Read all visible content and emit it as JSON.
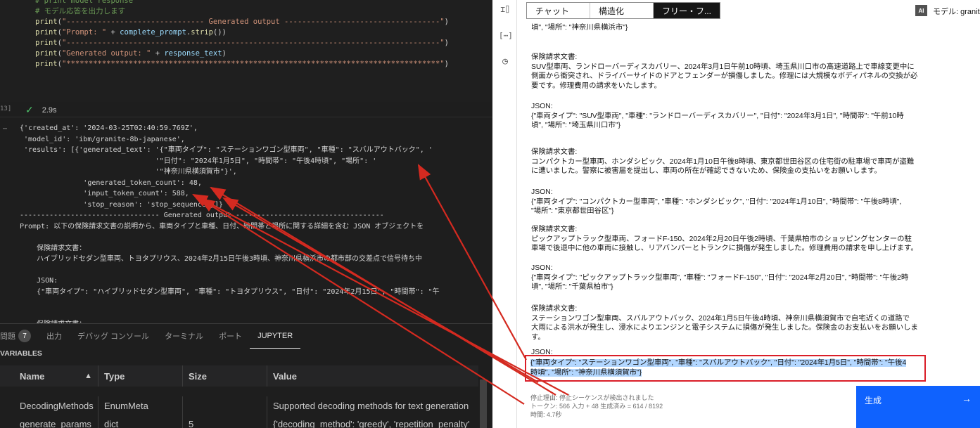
{
  "code": {
    "lines": [
      {
        "parts": [
          {
            "cls": "c-com",
            "t": "# print model response"
          }
        ]
      },
      {
        "parts": [
          {
            "cls": "c-com",
            "t": "# モデル応答を出力します"
          }
        ]
      },
      {
        "parts": [
          {
            "cls": "c-fn",
            "t": "print"
          },
          {
            "cls": "",
            "t": "("
          },
          {
            "cls": "c-str",
            "t": "\"------------------------------- Generated output -----------------------------------\""
          },
          {
            "cls": "",
            "t": ")"
          }
        ]
      },
      {
        "parts": [
          {
            "cls": "c-fn",
            "t": "print"
          },
          {
            "cls": "",
            "t": "("
          },
          {
            "cls": "c-str",
            "t": "\"Prompt: \""
          },
          {
            "cls": "",
            "t": " + "
          },
          {
            "cls": "c-var",
            "t": "complete_prompt"
          },
          {
            "cls": "",
            "t": "."
          },
          {
            "cls": "c-fn",
            "t": "strip"
          },
          {
            "cls": "",
            "t": "())"
          }
        ]
      },
      {
        "parts": [
          {
            "cls": "c-fn",
            "t": "print"
          },
          {
            "cls": "",
            "t": "("
          },
          {
            "cls": "c-str",
            "t": "\"------------------------------------------------------------------------------------\""
          },
          {
            "cls": "",
            "t": ")"
          }
        ]
      },
      {
        "parts": [
          {
            "cls": "c-fn",
            "t": "print"
          },
          {
            "cls": "",
            "t": "("
          },
          {
            "cls": "c-str",
            "t": "\"Generated output: \""
          },
          {
            "cls": "",
            "t": " + "
          },
          {
            "cls": "c-var",
            "t": "response_text"
          },
          {
            "cls": "",
            "t": ")"
          }
        ]
      },
      {
        "parts": [
          {
            "cls": "c-fn",
            "t": "print"
          },
          {
            "cls": "",
            "t": "("
          },
          {
            "cls": "c-str",
            "t": "\"************************************************************************************\""
          },
          {
            "cls": "",
            "t": ")"
          }
        ]
      }
    ],
    "cell_number": "13]",
    "elapsed": "2.9s"
  },
  "output": {
    "lines": [
      "{'created_at': '2024-03-25T02:40:59.769Z',",
      " 'model_id': 'ibm/granite-8b-japanese',",
      " 'results': [{'generated_text': '{\"車両タイプ\": \"ステーションワゴン型車両\", \"車種\": \"スバルアウトバック\", '",
      "                                '\"日付\": \"2024年1月5日\", \"時間帯\": \"午後4時頃\", \"場所\": '",
      "                                '\"神奈川県横須賀市\"}',",
      "               'generated_token_count': 48,",
      "               'input_token_count': 588,",
      "               'stop_reason': 'stop_sequence'}]}",
      "--------------------------------- Generated output -----------------------------------",
      "Prompt: 以下の保険請求文書の説明から、車両タイプと車種、日付、時間帯と場所に関する詳細を含む JSON オブジェクトを",
      "",
      "    保険請求文書：",
      "    ハイブリッドセダン型車両、トヨタプリウス、2024年2月15日午後3時頃、神奈川県横浜市の都市部の交差点で信号待ち中",
      "",
      "    JSON:",
      "    {\"車両タイプ\": \"ハイブリッドセダン型車両\", \"車種\": \"トヨタプリウス\", \"日付\": \"2024年2月15日\", \"時間帯\": \"午",
      "",
      "",
      "    保険請求文書："
    ]
  },
  "panel": {
    "tabs": [
      {
        "label": "問題",
        "badge": "7"
      },
      {
        "label": "出力"
      },
      {
        "label": "デバッグ コンソール"
      },
      {
        "label": "ターミナル"
      },
      {
        "label": "ポート"
      },
      {
        "label": "JUPYTER",
        "active": true
      }
    ],
    "variables_title": "VARIABLES",
    "columns": [
      "Name",
      "Type",
      "Size",
      "Value"
    ],
    "rows": [
      [
        "DecodingMethods",
        "EnumMeta",
        "",
        "Supported decoding methods for text generation"
      ],
      [
        "generate_params",
        "dict",
        "5",
        "{'decoding_method': 'greedy', 'repetition_penalty'"
      ]
    ]
  },
  "prompt_lab": {
    "tabs": [
      "チャット",
      "構造化",
      "フリー・フ..."
    ],
    "active_tab": 2,
    "ai_badge": "AI",
    "model_label": "モデル: granite",
    "blocks": [
      {
        "lines": [
          "頃\", \"場所\": \"神奈川県横浜市\"}"
        ]
      },
      {
        "lines": [
          "保険請求文書:",
          "SUV型車両、ランドローバーディスカバリー、2024年3月1日午前10時頃、埼玉県川口市の高速道路上で車線変更中に",
          "側面から衝突され、ドライバーサイドのドアとフェンダーが損傷しました。修理には大規模なボディパネルの交換が必",
          "要です。修理費用の請求をいたします。"
        ]
      },
      {
        "lines": [
          "JSON:",
          "{\"車両タイプ\": \"SUV型車両\", \"車種\": \"ランドローバーディスカバリー\", \"日付\": \"2024年3月1日\", \"時間帯\": \"午前10時",
          "頃\", \"場所\": \"埼玉県川口市\"}"
        ]
      },
      {
        "lines": [
          "保険請求文書:",
          "コンパクトカー型車両、ホンダシビック、2024年1月10日午後8時頃、東京都世田谷区の住宅街の駐車場で車両が盗難",
          "に遭いました。警察に被害届を提出し、車両の所在が確認できないため、保険金の支払いをお願いします。"
        ]
      },
      {
        "lines": [
          "JSON:",
          "{\"車両タイプ\": \"コンパクトカー型車両\", \"車種\": \"ホンダシビック\", \"日付\": \"2024年1月10日\", \"時間帯\": \"午後8時頃\",",
          "\"場所\": \"東京都世田谷区\"}"
        ]
      },
      {
        "lines": [
          "保険請求文書:",
          "ピックアップトラック型車両、フォードF-150、2024年2月20日午後2時頃、千葉県柏市のショッピングセンターの駐",
          "車場で後退中に他の車両に接触し、リアバンパーとトランクに損傷が発生しました。修理費用の請求を申し上げます。"
        ]
      },
      {
        "lines": [
          "JSON:",
          "{\"車両タイプ\": \"ピックアップトラック型車両\", \"車種\": \"フォードF-150\", \"日付\": \"2024年2月20日\", \"時間帯\": \"午後2時",
          "頃\", \"場所\": \"千葉県柏市\"}"
        ]
      },
      {
        "lines": [
          "保険請求文書:",
          "ステーションワゴン型車両、スバルアウトバック、2024年1月5日午後4時頃、神奈川県横須賀市で自宅近くの道路で",
          "大雨による洪水が発生し、浸水によりエンジンと電子システムに損傷が発生しました。保険金のお支払いをお願いしま",
          "す。"
        ]
      },
      {
        "lines": [
          "JSON:"
        ]
      }
    ],
    "generated_lines": [
      "{\"車両タイプ\": \"ステーションワゴン型車両\", \"車種\": \"スバルアウトバック\", \"日付\": \"2024年1月5日\", \"時間帯\": \"午後4",
      "時頃\", \"場所\": \"神奈川県横須賀市\"}"
    ],
    "status_lines": [
      "停止理由: 停止シーケンスが検出されました",
      "トークン: 566 入力 + 48 生成済み = 614 / 8192",
      "時間: 4.7秒"
    ],
    "generate_label": "生成",
    "generate_arrow": "→"
  }
}
